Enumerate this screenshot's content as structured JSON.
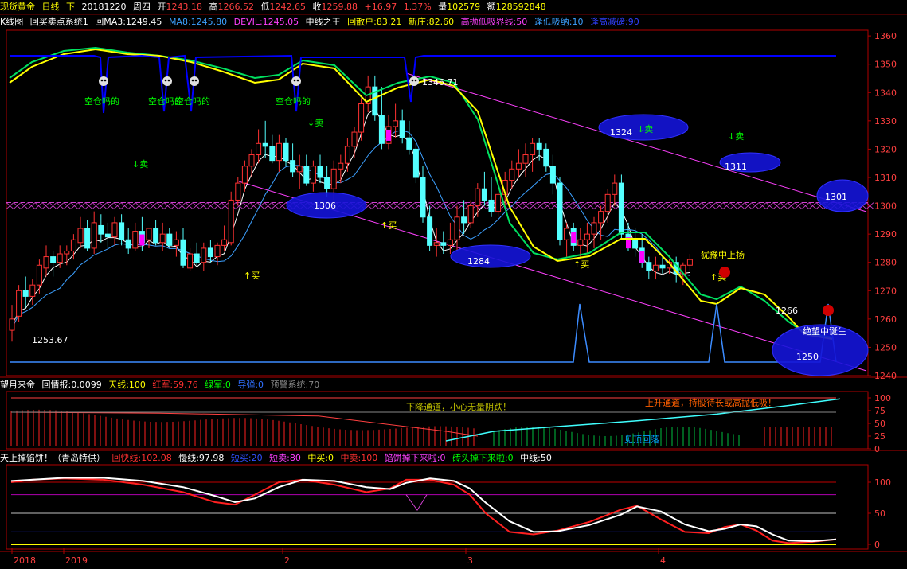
{
  "header": {
    "symbol": "现货黄金",
    "period": "日线",
    "dir": "下",
    "date": "20181220",
    "weekday": "周四",
    "open_label": "开",
    "open": "1243.18",
    "high_label": "高",
    "high": "1266.52",
    "low_label": "低",
    "low": "1242.65",
    "close_label": "收",
    "close": "1259.88",
    "change": "+16.97",
    "change_pct": "1.37%",
    "vol_label": "量",
    "vol": "102579",
    "amt_label": "额",
    "amt": "128592848"
  },
  "main_legend": {
    "chart_name": "K线图",
    "system": "回买卖点系统1",
    "ma3": "回MA3:1249.45",
    "ma8": "MA8:1245.80",
    "devil": "DEVIL:1245.05",
    "king": "中线之王",
    "retail": "回散户:83.21",
    "newbie": "新庄:82.60",
    "hlb": "高抛低吸界线:50",
    "low_buy": "逢低吸纳:10",
    "high_sell": "逢高减磅:90"
  },
  "panel2_legend": {
    "name": "望月来金",
    "info": "回情报:0.0099",
    "tianxian": "天线:100",
    "hongjun": "红军:59.76",
    "lvjun": "绿军:0",
    "daodan": "导弹:0",
    "warn": "预警系统:70"
  },
  "panel3_legend": {
    "name": "天上掉馅饼！（青岛特供）",
    "fast": "回快线:102.08",
    "slow": "慢线:97.98",
    "short_buy": "短买:20",
    "short_sell": "短卖:80",
    "mid_buy": "中买:0",
    "mid_sell": "中卖:100",
    "pie": "馅饼掉下来啦:0",
    "brick": "砖头掉下来啦:0",
    "mid": "中线:50"
  },
  "annotations": {
    "high_val": "1346.71",
    "low_val": "1253.67",
    "v1324": "1324",
    "v1311": "1311",
    "v1306": "1306",
    "v1301": "1301",
    "v1284": "1284",
    "v1266": "1266",
    "v1250": "1250",
    "sell": "↓卖",
    "buy": "↑买",
    "kong": "空仓吗的",
    "hesitate": "犹豫中上扬",
    "despair": "绝望中诞生",
    "down_channel": "下降通道，小心无量阴跌！",
    "up_channel": "上升通道，持股待长或高抛低吸！",
    "top": "见顶回落"
  },
  "axis": {
    "price_ticks": [
      "1360",
      "1350",
      "1340",
      "1330",
      "1320",
      "1310",
      "1300",
      "1290",
      "1280",
      "1270",
      "1260",
      "1250",
      "1240"
    ],
    "p2_ticks": [
      "100",
      "75",
      "50",
      "25",
      "0"
    ],
    "p3_ticks": [
      "100",
      "50",
      "0"
    ],
    "date_labels": [
      "2018",
      "2019",
      "2",
      "3",
      "4"
    ]
  },
  "colors": {
    "up": "#ff3232",
    "down": "#54ffff",
    "ma3": "#ffffff",
    "ma8": "#3ca0ff",
    "yellow": "#ffff00",
    "green": "#00e060",
    "blue": "#0000ff",
    "magenta": "#ff00ff"
  },
  "chart_data": {
    "type": "candlestick",
    "ylim": [
      1240,
      1362
    ],
    "candles": [
      [
        1256,
        1265,
        1252,
        1260
      ],
      [
        1261,
        1272,
        1259,
        1270
      ],
      [
        1270,
        1275,
        1264,
        1268
      ],
      [
        1268,
        1274,
        1265,
        1272
      ],
      [
        1272,
        1281,
        1269,
        1279
      ],
      [
        1278,
        1286,
        1275,
        1282
      ],
      [
        1282,
        1284,
        1275,
        1280
      ],
      [
        1280,
        1286,
        1278,
        1283
      ],
      [
        1283,
        1286,
        1279,
        1284
      ],
      [
        1284,
        1290,
        1281,
        1288
      ],
      [
        1287,
        1296,
        1285,
        1292
      ],
      [
        1292,
        1295,
        1284,
        1285
      ],
      [
        1285,
        1298,
        1283,
        1294
      ],
      [
        1293,
        1297,
        1287,
        1290
      ],
      [
        1290,
        1294,
        1285,
        1289
      ],
      [
        1289,
        1296,
        1286,
        1294
      ],
      [
        1294,
        1297,
        1286,
        1288
      ],
      [
        1288,
        1292,
        1283,
        1285
      ],
      [
        1285,
        1294,
        1284,
        1291
      ],
      [
        1291,
        1296,
        1284,
        1287
      ],
      [
        1288,
        1292,
        1285,
        1292
      ],
      [
        1292,
        1295,
        1286,
        1287
      ],
      [
        1287,
        1294,
        1284,
        1290
      ],
      [
        1290,
        1292,
        1285,
        1286
      ],
      [
        1286,
        1291,
        1282,
        1288
      ],
      [
        1288,
        1292,
        1278,
        1279
      ],
      [
        1278,
        1285,
        1277,
        1283
      ],
      [
        1283,
        1287,
        1279,
        1280
      ],
      [
        1280,
        1287,
        1277,
        1285
      ],
      [
        1285,
        1288,
        1280,
        1282
      ],
      [
        1282,
        1287,
        1279,
        1286
      ],
      [
        1286,
        1293,
        1284,
        1288
      ],
      [
        1287,
        1305,
        1286,
        1302
      ],
      [
        1302,
        1310,
        1300,
        1308
      ],
      [
        1308,
        1316,
        1305,
        1314
      ],
      [
        1314,
        1320,
        1310,
        1318
      ],
      [
        1318,
        1327,
        1315,
        1322
      ],
      [
        1322,
        1330,
        1317,
        1321
      ],
      [
        1321,
        1325,
        1315,
        1316
      ],
      [
        1316,
        1325,
        1312,
        1322
      ],
      [
        1322,
        1324,
        1314,
        1316
      ],
      [
        1316,
        1322,
        1310,
        1312
      ],
      [
        1312,
        1318,
        1306,
        1314
      ],
      [
        1314,
        1318,
        1307,
        1308
      ],
      [
        1308,
        1316,
        1305,
        1314
      ],
      [
        1314,
        1318,
        1308,
        1310
      ],
      [
        1310,
        1314,
        1303,
        1306
      ],
      [
        1306,
        1316,
        1302,
        1313
      ],
      [
        1313,
        1318,
        1308,
        1315
      ],
      [
        1315,
        1324,
        1312,
        1321
      ],
      [
        1321,
        1328,
        1317,
        1326
      ],
      [
        1326,
        1338,
        1323,
        1336
      ],
      [
        1336,
        1346,
        1333,
        1342
      ],
      [
        1342,
        1346,
        1330,
        1332
      ],
      [
        1332,
        1342,
        1320,
        1322
      ],
      [
        1322,
        1332,
        1320,
        1328
      ],
      [
        1328,
        1336,
        1324,
        1330
      ],
      [
        1330,
        1334,
        1322,
        1324
      ],
      [
        1324,
        1330,
        1318,
        1320
      ],
      [
        1320,
        1322,
        1308,
        1310
      ],
      [
        1310,
        1314,
        1294,
        1296
      ],
      [
        1296,
        1300,
        1284,
        1286
      ],
      [
        1286,
        1292,
        1282,
        1287
      ],
      [
        1287,
        1291,
        1283,
        1286
      ],
      [
        1286,
        1294,
        1283,
        1288
      ],
      [
        1288,
        1300,
        1284,
        1296
      ],
      [
        1296,
        1302,
        1290,
        1294
      ],
      [
        1294,
        1302,
        1292,
        1300
      ],
      [
        1300,
        1308,
        1296,
        1306
      ],
      [
        1306,
        1312,
        1300,
        1302
      ],
      [
        1302,
        1310,
        1296,
        1298
      ],
      [
        1298,
        1308,
        1296,
        1304
      ],
      [
        1304,
        1312,
        1300,
        1309
      ],
      [
        1309,
        1316,
        1306,
        1313
      ],
      [
        1313,
        1320,
        1310,
        1315
      ],
      [
        1315,
        1322,
        1310,
        1318
      ],
      [
        1318,
        1324,
        1312,
        1322
      ],
      [
        1322,
        1324,
        1316,
        1320
      ],
      [
        1320,
        1322,
        1312,
        1314
      ],
      [
        1314,
        1318,
        1304,
        1308
      ],
      [
        1308,
        1310,
        1286,
        1288
      ],
      [
        1288,
        1294,
        1282,
        1292
      ],
      [
        1292,
        1294,
        1284,
        1286
      ],
      [
        1286,
        1292,
        1282,
        1288
      ],
      [
        1288,
        1294,
        1283,
        1290
      ],
      [
        1290,
        1296,
        1285,
        1294
      ],
      [
        1294,
        1300,
        1288,
        1298
      ],
      [
        1298,
        1306,
        1294,
        1304
      ],
      [
        1304,
        1311,
        1300,
        1308
      ],
      [
        1308,
        1311,
        1288,
        1290
      ],
      [
        1290,
        1294,
        1284,
        1288
      ],
      [
        1288,
        1292,
        1282,
        1285
      ],
      [
        1285,
        1290,
        1278,
        1280
      ],
      [
        1280,
        1282,
        1274,
        1277
      ],
      [
        1277,
        1282,
        1274,
        1279
      ],
      [
        1279,
        1282,
        1276,
        1278
      ],
      [
        1278,
        1281,
        1276,
        1280
      ],
      [
        1280,
        1282,
        1273,
        1276
      ],
      [
        1276,
        1280,
        1272,
        1279
      ],
      [
        1279,
        1283,
        1277,
        1281
      ]
    ]
  }
}
